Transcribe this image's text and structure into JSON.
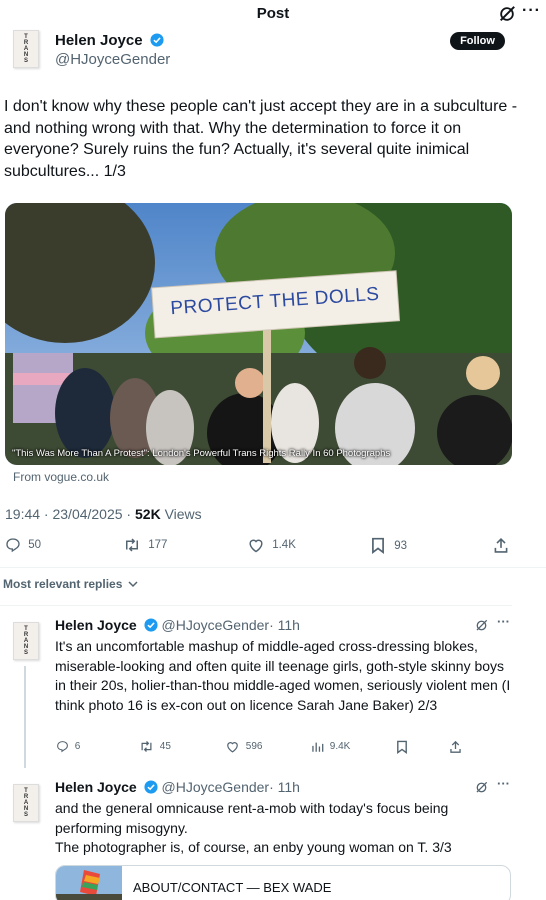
{
  "header": {
    "title": "Post"
  },
  "post": {
    "author_name": "Helen Joyce",
    "author_handle": "@HJoyceGender",
    "follow_label": "Follow",
    "text": "I don't know why these people can't just accept they are in a subculture - and nothing wrong with that. Why the determination to force it on everyone? Surely ruins the fun? Actually, it's several quite inimical subcultures... 1/3",
    "media_sign": "PROTECT THE DOLLS",
    "media_caption": "\"This Was More Than A Protest\": London's Powerful Trans Rights Rally In 60 Photographs",
    "source": "From vogue.co.uk",
    "timestamp": "19:44 · 23/04/2025 · ",
    "views_count": "52K",
    "views_label": " Views",
    "replies": "50",
    "reposts": "177",
    "likes": "1.4K",
    "bookmarks": "93"
  },
  "sort": {
    "label": "Most relevant replies"
  },
  "replies": [
    {
      "author_name": "Helen Joyce",
      "author_handle": "@HJoyceGender",
      "time": "· 11h",
      "text": "It's an uncomfortable mashup of middle-aged cross-dressing blokes, miserable-looking and often quite ill teenage girls, goth-style skinny boys in their 20s, holier-than-thou middle-aged women, seriously violent men (I think photo 16 is ex-con out on licence Sarah Jane Baker) 2/3",
      "replies": "6",
      "reposts": "45",
      "likes": "596",
      "views": "9.4K"
    },
    {
      "author_name": "Helen Joyce",
      "author_handle": "@HJoyceGender",
      "time": "· 11h",
      "text": "and the general omnicause rent-a-mob with today's focus being performing misogyny.\nThe photographer is, of course, an enby young woman on T. 3/3",
      "card_label": "ABOUT/CONTACT — BEX WADE"
    }
  ],
  "avatar_text": "TRANS",
  "colors": {
    "accent": "#1d9bf0",
    "text": "#0f1419",
    "muted": "#536471",
    "divider": "#eff3f4"
  }
}
